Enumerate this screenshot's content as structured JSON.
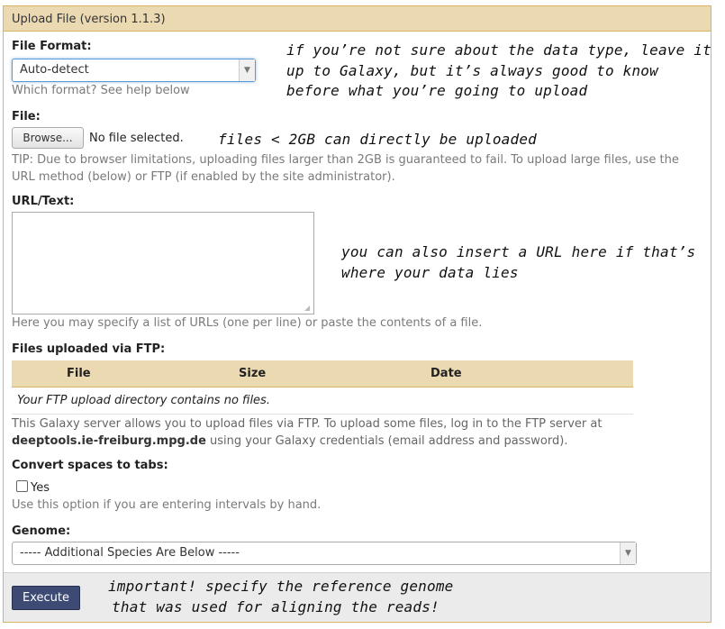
{
  "panel": {
    "title": "Upload File (version 1.1.3)"
  },
  "file_format": {
    "label": "File Format:",
    "selected": "Auto-detect",
    "help": "Which format? See help below",
    "note_lines": [
      "if you’re not sure about the data type, leave it",
      "up to Galaxy, but it’s always good to know",
      "before what you’re going to upload"
    ]
  },
  "file": {
    "label": "File:",
    "browse_label": "Browse...",
    "status": "No file selected.",
    "note": "files < 2GB can directly be uploaded",
    "tip_lines": [
      "TIP: Due to browser limitations, uploading files larger than 2GB is guaranteed to fail. To upload large files, use the",
      "URL method (below) or FTP (if enabled by the site administrator)."
    ]
  },
  "url_text": {
    "label": "URL/Text:",
    "value": "",
    "help": "Here you may specify a list of URLs (one per line) or paste the contents of a file.",
    "note_lines": [
      "you can also insert a URL here if that’s",
      "where your data lies"
    ]
  },
  "ftp": {
    "label": "Files uploaded via FTP:",
    "columns": [
      "File",
      "Size",
      "Date"
    ],
    "empty_message": "Your FTP upload directory contains no files.",
    "info_line1": "This Galaxy server allows you to upload files via FTP. To upload some files, log in to the FTP server at",
    "server": "deeptools.ie-freiburg.mpg.de",
    "info_line2_rest": " using your Galaxy credentials (email address and password)."
  },
  "convert": {
    "label": "Convert spaces to tabs:",
    "option": "Yes",
    "checked": false,
    "help": "Use this option if you are entering intervals by hand."
  },
  "genome": {
    "label": "Genome:",
    "selected": "----- Additional Species Are Below -----"
  },
  "footer": {
    "execute_label": "Execute",
    "note_lines": [
      "important! specify the reference genome",
      "that was used for aligning the reads!"
    ]
  },
  "colors": {
    "header_bg": "#ebd9b2",
    "border": "#d8b365",
    "execute_bg": "#3c4a74",
    "help_text": "#7a7a7a"
  },
  "icons": {
    "dropdown": "chevron-down-icon",
    "resize": "resize-grip-icon"
  }
}
